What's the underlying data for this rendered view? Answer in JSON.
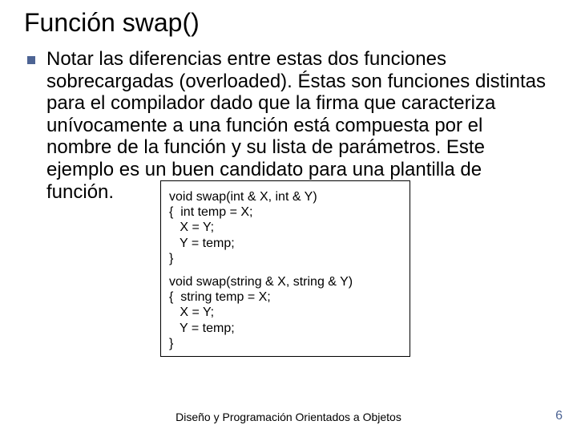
{
  "title": "Función swap()",
  "body": "Notar las diferencias entre estas dos funciones sobrecargadas (overloaded). Éstas son funciones distintas para el compilador dado que la firma que caracteriza unívocamente a una función está compuesta por el nombre de la función y su lista de parámetros. Este ejemplo es un buen candidato para una plantilla de función.",
  "code1": "void swap(int & X, int & Y)\n{  int temp = X;\n   X = Y;\n   Y = temp;\n}",
  "code2": "void swap(string & X, string & Y)\n{  string temp = X;\n   X = Y;\n   Y = temp;\n}",
  "footer": "Diseño y Programación Orientados a Objetos",
  "page": "6"
}
